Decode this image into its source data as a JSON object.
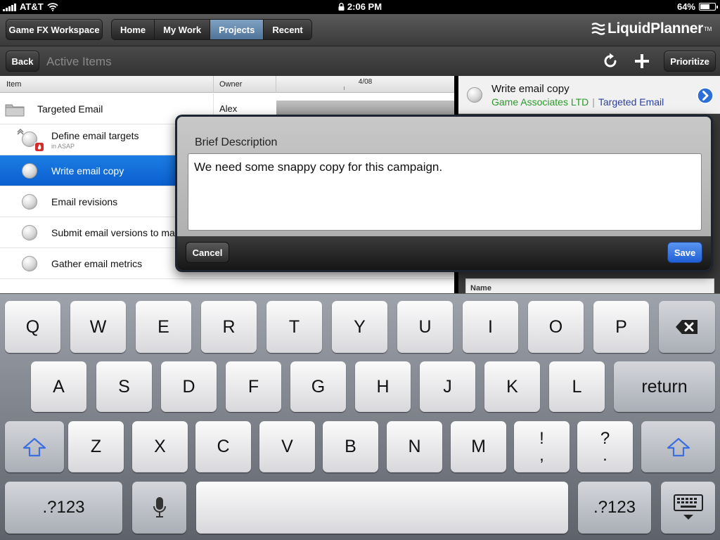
{
  "status_bar": {
    "carrier": "AT&T",
    "time": "2:06 PM",
    "battery": "64%",
    "battery_level": 0.64
  },
  "toolbar": {
    "workspace": "Game FX Workspace",
    "nav": [
      {
        "label": "Home",
        "active": false
      },
      {
        "label": "My Work",
        "active": false
      },
      {
        "label": "Projects",
        "active": true
      },
      {
        "label": "Recent",
        "active": false
      }
    ],
    "logo": "LiquidPlanner",
    "logo_tm": "TM"
  },
  "subbar": {
    "back": "Back",
    "title": "Active Items",
    "prioritize": "Prioritize"
  },
  "list": {
    "columns": {
      "item": "Item",
      "owner": "Owner",
      "date": "4/08"
    },
    "rows": [
      {
        "label": "Targeted Email",
        "owner": "Alex",
        "note": ""
      },
      {
        "label": "Define email targets",
        "owner": "",
        "note": "in ASAP"
      },
      {
        "label": "Write email copy",
        "owner": "",
        "note": ""
      },
      {
        "label": "Email revisions",
        "owner": "",
        "note": ""
      },
      {
        "label": "Submit email versions to ma",
        "owner": "",
        "note": ""
      },
      {
        "label": "Gather email metrics",
        "owner": "",
        "note": ""
      }
    ]
  },
  "detail": {
    "title": "Write email copy",
    "client": "Game Associates LTD",
    "separator": "|",
    "project": "Targeted Email",
    "name_header": "Name"
  },
  "modal": {
    "title": "Brief Description",
    "text": "We need some snappy copy for this campaign.",
    "cancel": "Cancel",
    "save": "Save"
  },
  "keyboard": {
    "row1": [
      "Q",
      "W",
      "E",
      "R",
      "T",
      "Y",
      "U",
      "I",
      "O",
      "P"
    ],
    "row2": [
      "A",
      "S",
      "D",
      "F",
      "G",
      "H",
      "J",
      "K",
      "L"
    ],
    "return": "return",
    "row3": [
      "Z",
      "X",
      "C",
      "V",
      "B",
      "N",
      "M"
    ],
    "punct1": [
      "!",
      ","
    ],
    "punct2": [
      "?",
      "."
    ],
    "numbers": ".?123"
  },
  "colors": {
    "selected_row": "#0b5fd0",
    "nav_active": "#5e86ad",
    "client_green": "#2a9a2a",
    "project_blue": "#2a3f9f",
    "save_blue": "#1f5fd6"
  }
}
